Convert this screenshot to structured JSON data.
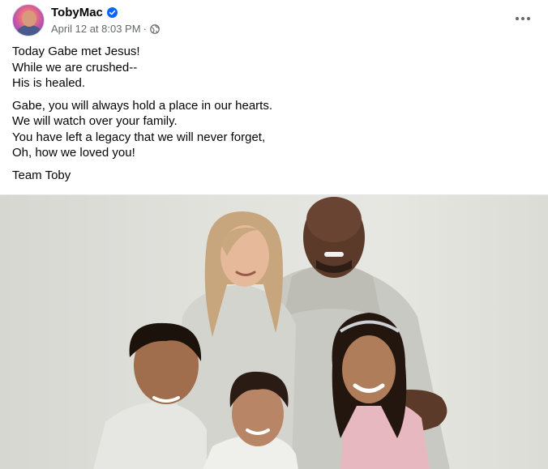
{
  "author": {
    "name": "TobyMac",
    "verified": true
  },
  "meta": {
    "timestamp": "April 12 at 8:03 PM",
    "separator": "·",
    "audience_icon": "globe-icon"
  },
  "post": {
    "paragraphs": [
      {
        "lines": [
          "Today Gabe met Jesus!",
          "While we are crushed--",
          "His is healed."
        ]
      },
      {
        "lines": [
          "Gabe, you will always hold a place in our hearts.",
          "We will watch over your family.",
          "You have left a legacy that we will never forget,",
          "Oh, how we loved you!"
        ]
      },
      {
        "lines": [
          "Team Toby"
        ]
      }
    ]
  },
  "icons": {
    "verified": "verified-badge-icon",
    "more": "more-options-icon"
  },
  "colors": {
    "verified_blue": "#0866ff",
    "secondary_text": "#65676b",
    "primary_text": "#050505"
  }
}
